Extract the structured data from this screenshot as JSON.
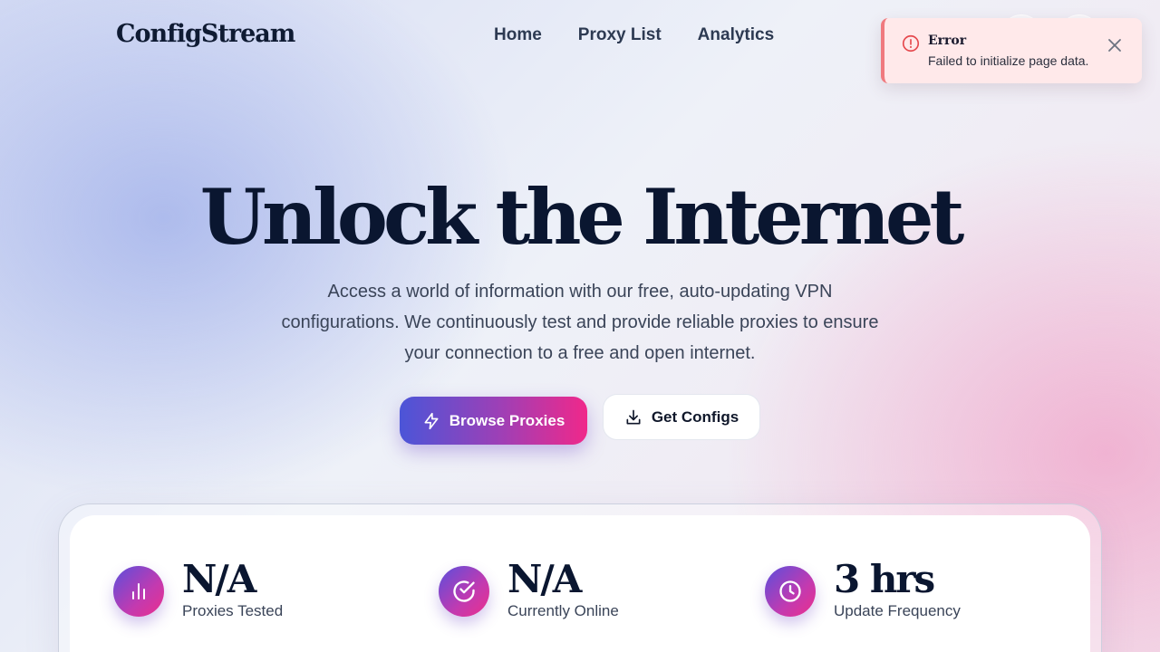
{
  "nav": {
    "logo": "ConfigStream",
    "links": [
      {
        "label": "Home"
      },
      {
        "label": "Proxy List"
      },
      {
        "label": "Analytics"
      }
    ]
  },
  "toast": {
    "title": "Error",
    "message": "Failed to initialize page data.",
    "icon": "alert-circle-icon",
    "accent_color": "#f07a7f",
    "background_color": "#ffe9ea"
  },
  "hero": {
    "title": "Unlock the Internet",
    "description": "Access a world of information with our free, auto-updating VPN configurations. We continuously test and provide reliable proxies to ensure your connection to a free and open internet.",
    "primary_button": {
      "label": "Browse Proxies",
      "icon": "lightning-icon"
    },
    "secondary_button": {
      "label": "Get Configs",
      "icon": "download-icon"
    }
  },
  "stats": [
    {
      "value": "N/A",
      "label": "Proxies Tested",
      "icon": "bar-chart-icon"
    },
    {
      "value": "N/A",
      "label": "Currently Online",
      "icon": "check-circle-icon"
    },
    {
      "value": "3 hrs",
      "label": "Update Frequency",
      "icon": "clock-icon"
    }
  ],
  "colors": {
    "brand_gradient_start": "#4b55d8",
    "brand_gradient_end": "#f0288a",
    "heading": "#0a1630"
  }
}
